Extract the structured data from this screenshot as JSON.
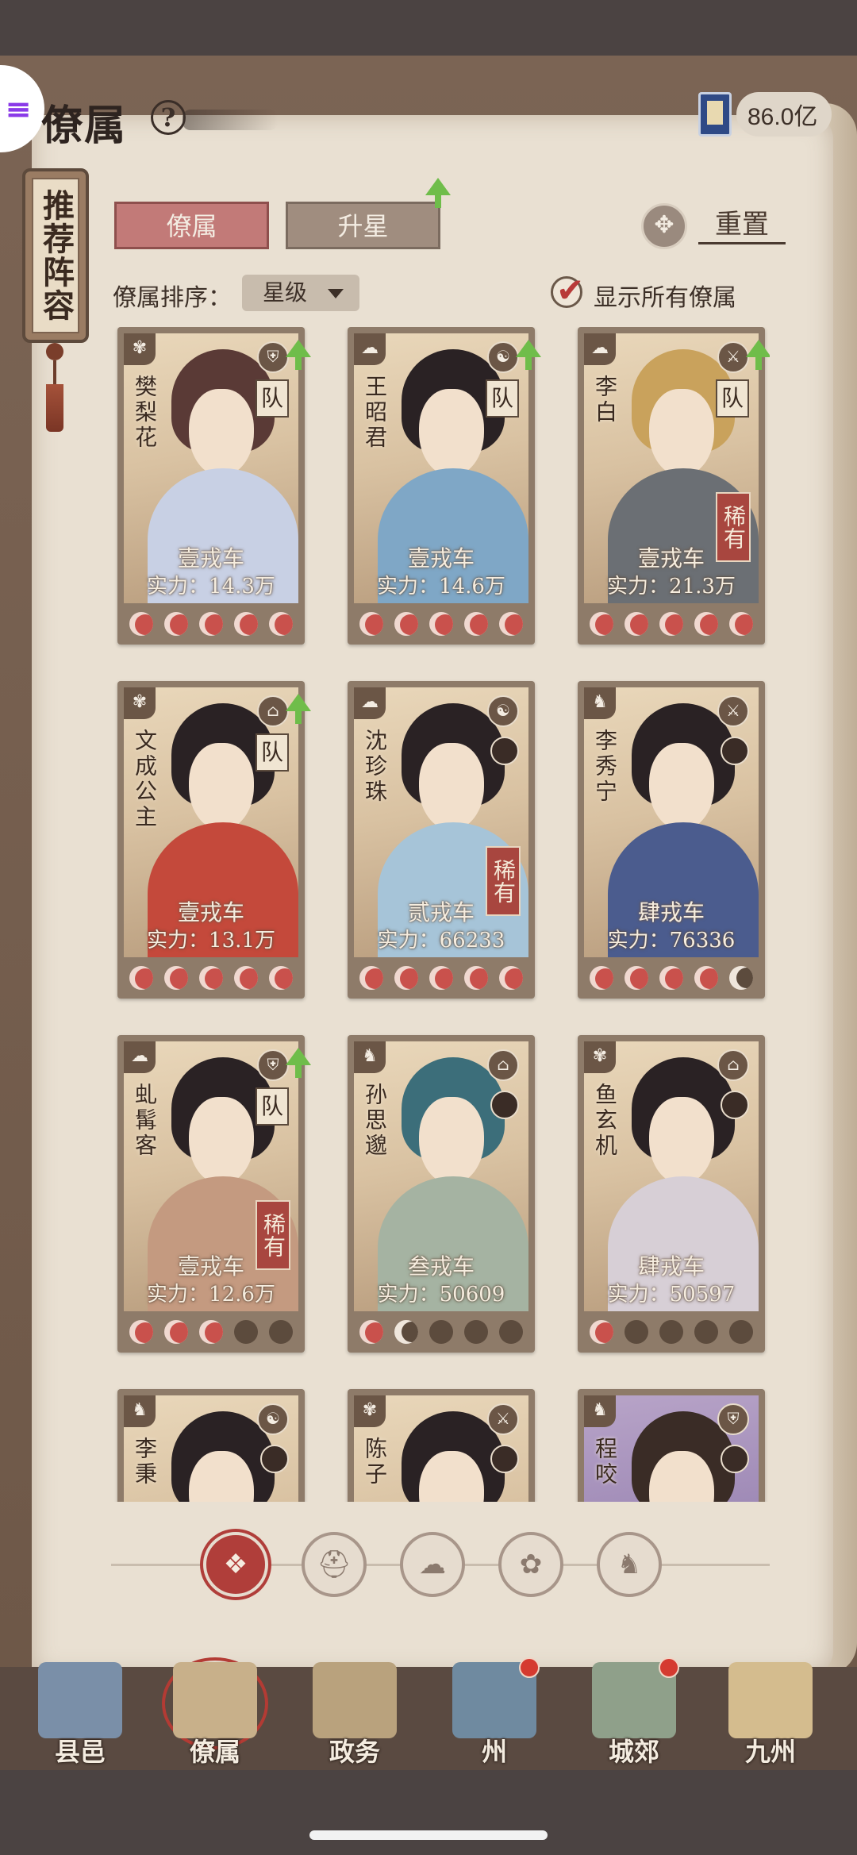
{
  "header": {
    "title": "僚属",
    "help_icon": "?",
    "currency_value": "86.0亿",
    "currency_icon": "book-icon"
  },
  "side_tab": {
    "label": "推荐阵容"
  },
  "tabs": [
    {
      "label": "僚属",
      "active": true
    },
    {
      "label": "升星",
      "active": false,
      "has_upgrade_arrow": true
    }
  ],
  "reset": {
    "label": "重置"
  },
  "sort": {
    "label": "僚属排序：",
    "selected": "星级"
  },
  "show_all": {
    "label": "显示所有僚属",
    "checked": true
  },
  "cards": [
    {
      "name": "樊梨花",
      "rank": "壹戎车",
      "power": "实力：14.3万",
      "team": "队",
      "rare": "",
      "upgrade": true,
      "stars": [
        "on",
        "on",
        "on",
        "on",
        "on"
      ],
      "hair": "#5a3a36",
      "body": "#c8d0e4",
      "faction_icon": "fan-icon",
      "class_icon": "shield-icon",
      "mini_avatar": false
    },
    {
      "name": "王昭君",
      "rank": "壹戎车",
      "power": "实力：14.6万",
      "team": "队",
      "rare": "",
      "upgrade": true,
      "stars": [
        "on",
        "on",
        "on",
        "on",
        "on"
      ],
      "hair": "#2a2224",
      "body": "#7fa7c6",
      "faction_icon": "cloud-icon",
      "class_icon": "taiji-icon",
      "mini_avatar": false
    },
    {
      "name": "李白",
      "rank": "壹戎车",
      "power": "实力：21.3万",
      "team": "队",
      "rare": "稀有",
      "upgrade": true,
      "stars": [
        "on",
        "on",
        "on",
        "on",
        "on"
      ],
      "hair": "#c9a25c",
      "body": "#6b6f74",
      "faction_icon": "cloud-icon",
      "class_icon": "sword-icon",
      "mini_avatar": false
    },
    {
      "name": "文成公主",
      "rank": "壹戎车",
      "power": "实力：13.1万",
      "team": "队",
      "rare": "",
      "upgrade": true,
      "stars": [
        "on",
        "on",
        "on",
        "on",
        "on"
      ],
      "hair": "#2a2224",
      "body": "#c4493b",
      "faction_icon": "fan-icon",
      "class_icon": "hat-icon",
      "mini_avatar": false
    },
    {
      "name": "沈珍珠",
      "rank": "贰戎车",
      "power": "实力：66233",
      "team": "",
      "rare": "稀有",
      "upgrade": false,
      "stars": [
        "on",
        "on",
        "on",
        "on",
        "on"
      ],
      "hair": "#2a2224",
      "body": "#a6c4d8",
      "faction_icon": "cloud-icon",
      "class_icon": "taiji-icon",
      "mini_avatar": true
    },
    {
      "name": "李秀宁",
      "rank": "肆戎车",
      "power": "实力：76336",
      "team": "",
      "rare": "",
      "upgrade": false,
      "stars": [
        "on",
        "on",
        "on",
        "on",
        "half"
      ],
      "hair": "#2a2224",
      "body": "#4b5c8e",
      "faction_icon": "lion-icon",
      "class_icon": "sword-icon",
      "mini_avatar": true
    },
    {
      "name": "虬髯客",
      "rank": "壹戎车",
      "power": "实力：12.6万",
      "team": "队",
      "rare": "稀有",
      "upgrade": true,
      "stars": [
        "on",
        "on",
        "on",
        "off",
        "off"
      ],
      "hair": "#2a2224",
      "body": "#c49a80",
      "faction_icon": "cloud-icon",
      "class_icon": "shield-icon",
      "mini_avatar": false
    },
    {
      "name": "孙思邈",
      "rank": "叁戎车",
      "power": "实力：50609",
      "team": "",
      "rare": "",
      "upgrade": false,
      "stars": [
        "on",
        "half",
        "off",
        "off",
        "off"
      ],
      "hair": "#3c6e7a",
      "body": "#a5b3a2",
      "faction_icon": "lion-icon",
      "class_icon": "hat-icon",
      "mini_avatar": true
    },
    {
      "name": "鱼玄机",
      "rank": "肆戎车",
      "power": "实力：50597",
      "team": "",
      "rare": "",
      "upgrade": false,
      "stars": [
        "on",
        "off",
        "off",
        "off",
        "off"
      ],
      "hair": "#2a2224",
      "body": "#d7cfd6",
      "faction_icon": "fan-icon",
      "class_icon": "hat-icon",
      "mini_avatar": true
    },
    {
      "name": "李秉",
      "rank": "",
      "power": "",
      "team": "",
      "rare": "",
      "upgrade": false,
      "stars": [],
      "hair": "#2a2224",
      "body": "#d8b9b0",
      "faction_icon": "lion-icon",
      "class_icon": "taiji-icon",
      "mini_avatar": true,
      "partial": true
    },
    {
      "name": "陈子",
      "rank": "",
      "power": "",
      "team": "",
      "rare": "",
      "upgrade": false,
      "stars": [],
      "hair": "#2a2224",
      "body": "#c9b69c",
      "faction_icon": "fan-icon",
      "class_icon": "sword-icon",
      "mini_avatar": true,
      "partial": true
    },
    {
      "name": "程咬",
      "rank": "",
      "power": "",
      "team": "",
      "rare": "",
      "upgrade": false,
      "stars": [],
      "hair": "#3a2c26",
      "body": "#9d88b5",
      "faction_icon": "lion-icon",
      "class_icon": "shield-icon",
      "mini_avatar": true,
      "partial": true,
      "purple": true
    }
  ],
  "filters": [
    {
      "name": "all-filter",
      "glyph": "❖",
      "active": true
    },
    {
      "name": "helmet-filter",
      "glyph": "⛑",
      "active": false
    },
    {
      "name": "cloud-filter",
      "glyph": "☁",
      "active": false
    },
    {
      "name": "fan-filter",
      "glyph": "✿",
      "active": false
    },
    {
      "name": "lion-filter",
      "glyph": "♞",
      "active": false
    }
  ],
  "nav": [
    {
      "label": "县邑",
      "color": "#7a8fa8",
      "selected": false,
      "dot": false
    },
    {
      "label": "僚属",
      "color": "#c8b08a",
      "selected": true,
      "dot": false
    },
    {
      "label": "政务",
      "color": "#b9a27d",
      "selected": false,
      "dot": false
    },
    {
      "label": "州",
      "color": "#6f8aa0",
      "selected": false,
      "dot": true
    },
    {
      "label": "城郊",
      "color": "#8fa08a",
      "selected": false,
      "dot": true
    },
    {
      "label": "九州",
      "color": "#d4bc8e",
      "selected": false,
      "dot": false
    }
  ]
}
